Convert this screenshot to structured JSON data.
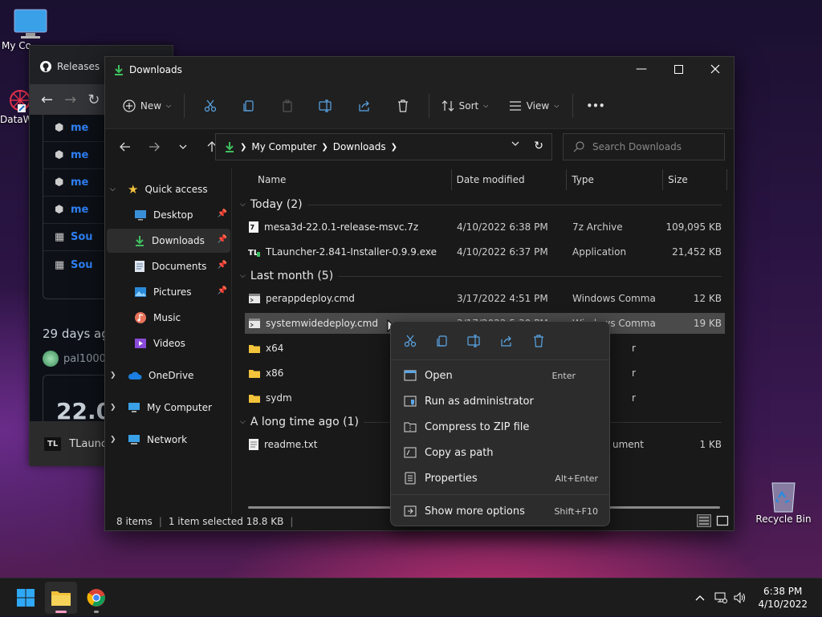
{
  "desktop": {
    "icons": [
      {
        "label": "My Co"
      },
      {
        "label": "DataW"
      },
      {
        "label": "Recycle Bin"
      }
    ]
  },
  "browser": {
    "tab_title": "Releases",
    "assets": [
      "me",
      "me",
      "me",
      "me",
      "Sou",
      "Sou"
    ],
    "ago": "29 days ag",
    "user": "pal1000",
    "version": "22.0",
    "taskbar_item": "TLaunch"
  },
  "explorer": {
    "title": "Downloads",
    "toolbar": {
      "new_label": "New",
      "sort_label": "Sort",
      "view_label": "View",
      "more": "•••"
    },
    "path": [
      "My Computer",
      "Downloads"
    ],
    "search_placeholder": "Search Downloads",
    "nav": {
      "quick_access": "Quick access",
      "items": [
        {
          "label": "Desktop"
        },
        {
          "label": "Downloads"
        },
        {
          "label": "Documents"
        },
        {
          "label": "Pictures"
        },
        {
          "label": "Music"
        },
        {
          "label": "Videos"
        }
      ],
      "onedrive": "OneDrive",
      "mycomputer": "My Computer",
      "network": "Network"
    },
    "columns": [
      "Name",
      "Date modified",
      "Type",
      "Size"
    ],
    "groups": [
      {
        "label": "Today (2)"
      },
      {
        "label": "Last month (5)"
      },
      {
        "label": "A long time ago (1)"
      }
    ],
    "files": [
      {
        "name": "mesa3d-22.0.1-release-msvc.7z",
        "date": "4/10/2022 6:38 PM",
        "type": "7z Archive",
        "size": "109,095 KB"
      },
      {
        "name": "TLauncher-2.841-Installer-0.9.9.exe",
        "date": "4/10/2022 6:37 PM",
        "type": "Application",
        "size": "21,452 KB"
      },
      {
        "name": "perappdeploy.cmd",
        "date": "3/17/2022 4:51 PM",
        "type": "Windows Comma...",
        "size": "12 KB"
      },
      {
        "name": "systemwidedeploy.cmd",
        "date": "3/17/2022 5:30 PM",
        "type": "Windows Comma...",
        "size": "19 KB"
      },
      {
        "name": "x64",
        "date": "",
        "type": "r",
        "size": ""
      },
      {
        "name": "x86",
        "date": "",
        "type": "r",
        "size": ""
      },
      {
        "name": "sydm",
        "date": "",
        "type": "r",
        "size": ""
      },
      {
        "name": "readme.txt",
        "date": "",
        "type": "ument",
        "size": "1 KB"
      }
    ],
    "status": {
      "count": "8 items",
      "selected": "1 item selected  18.8 KB"
    }
  },
  "context_menu": {
    "items": [
      {
        "label": "Open",
        "shortcut": "Enter"
      },
      {
        "label": "Run as administrator",
        "shortcut": ""
      },
      {
        "label": "Compress to ZIP file",
        "shortcut": ""
      },
      {
        "label": "Copy as path",
        "shortcut": ""
      },
      {
        "label": "Properties",
        "shortcut": "Alt+Enter"
      },
      {
        "label": "Show more options",
        "shortcut": "Shift+F10"
      }
    ]
  },
  "taskbar": {
    "time": "6:38 PM",
    "date": "4/10/2022"
  },
  "colors": {
    "accent": "#0078d4",
    "folder": "#f3c33b",
    "download_green": "#3fbf5f"
  }
}
